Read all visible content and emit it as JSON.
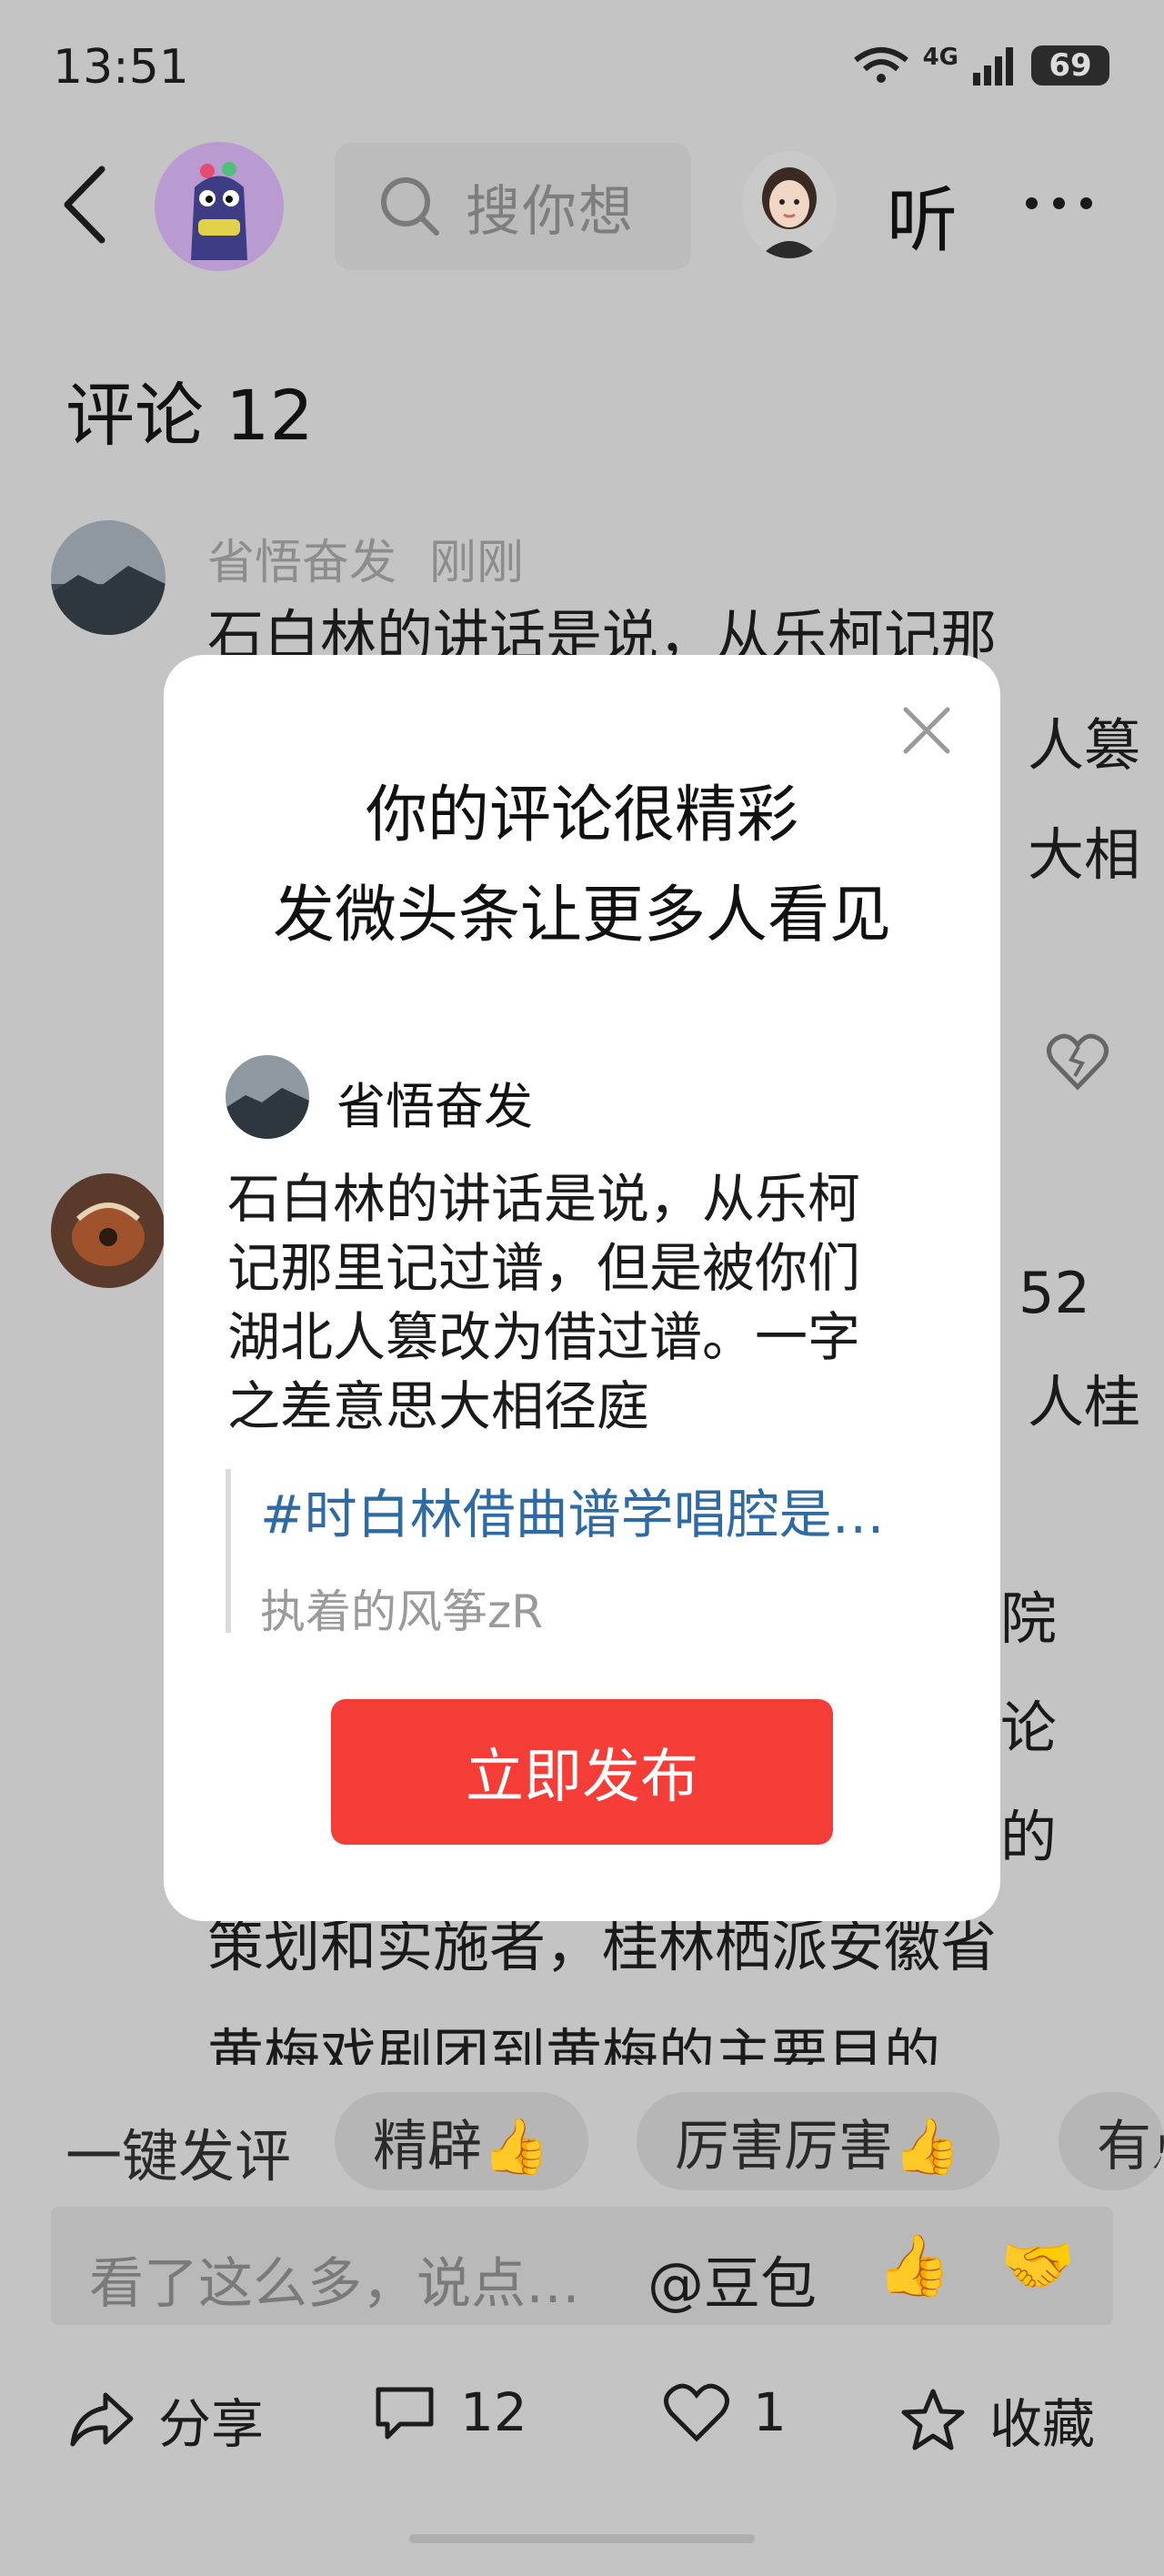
{
  "status_bar": {
    "time": "13:51",
    "network": "4G",
    "battery": "69"
  },
  "header": {
    "search_placeholder": "搜你想",
    "listen_label": "听"
  },
  "comments": {
    "title": "评论 12",
    "first": {
      "author": "省悟奋发",
      "time": "刚刚",
      "lines": [
        "石白林的讲话是说，从乐柯记那",
        "人篡",
        "大相"
      ]
    },
    "second": {
      "line_fragments": [
        "52",
        "人桂"
      ]
    },
    "third": {
      "line_fragments": [
        "院",
        "论",
        "的"
      ],
      "lines": [
        "策划和实施者，桂林栖派安徽省",
        "黄梅戏剧团到黄梅的主要目的"
      ]
    }
  },
  "popup": {
    "title_line1": "你的评论很精彩",
    "title_line2": "发微头条让更多人看见",
    "author": "省悟奋发",
    "quote": "石白林的讲话是说，从乐柯\n记那里记过谱，但是被你们\n湖北人篡改为借过谱。一字\n之差意思大相径庭",
    "topic": "#时白林借曲谱学唱腔是…",
    "topic_author": "执着的风筝zR",
    "publish_button": "立即发布"
  },
  "quick_reply": {
    "label": "一键发评",
    "chips": [
      "精辟👍",
      "厉害厉害👍",
      "有点"
    ]
  },
  "input": {
    "placeholder": "看了这么多，说点…",
    "mention": "@豆包",
    "emoji_1": "👍",
    "emoji_2": "🤝"
  },
  "actions": {
    "share": "分享",
    "comments": "12",
    "likes": "1",
    "favorite": "收藏"
  },
  "colors": {
    "primary_red": "#f43d37",
    "topic_blue": "#2e6aa3",
    "dim_background": "#c4c4c4"
  }
}
